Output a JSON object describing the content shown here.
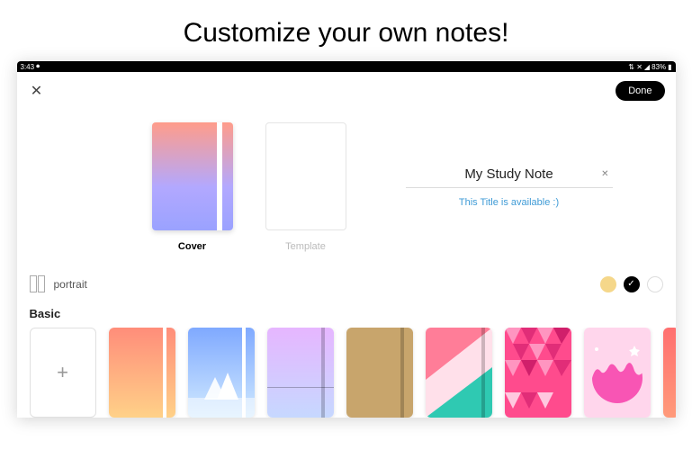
{
  "heading": "Customize your own notes!",
  "status": {
    "time": "3:43",
    "battery": "83%"
  },
  "toolbar": {
    "done_label": "Done"
  },
  "preview": {
    "cover_label": "Cover",
    "template_label": "Template"
  },
  "title": {
    "value": "My Study Note",
    "availability": "This Title is available :)"
  },
  "orientation": {
    "label": "portrait"
  },
  "swatches": [
    {
      "color": "#f5d78a",
      "selected": false
    },
    {
      "color": "#000000",
      "selected": true
    },
    {
      "color": "#ffffff",
      "selected": false,
      "bordered": true
    }
  ],
  "section_label": "Basic",
  "covers": [
    {
      "type": "add"
    },
    {
      "type": "gradient",
      "from": "#ff8d7a",
      "to": "#ffd188",
      "spine": "white"
    },
    {
      "type": "gradient",
      "from": "#7fa9ff",
      "to": "#d1eaff",
      "spine": "white",
      "mountain": true
    },
    {
      "type": "gradient",
      "from": "#e6b6ff",
      "to": "#c6d8ff",
      "spine": "dark"
    },
    {
      "type": "solid",
      "color": "#c8a56c",
      "spine": "dark"
    },
    {
      "type": "geo",
      "c1": "#ff7d98",
      "c2": "#ffe0ea",
      "c3": "#2fc9b2"
    },
    {
      "type": "triangles"
    },
    {
      "type": "drip"
    },
    {
      "type": "gradient",
      "from": "#ff6f6f",
      "to": "#ff9a7a",
      "partial": true
    }
  ]
}
